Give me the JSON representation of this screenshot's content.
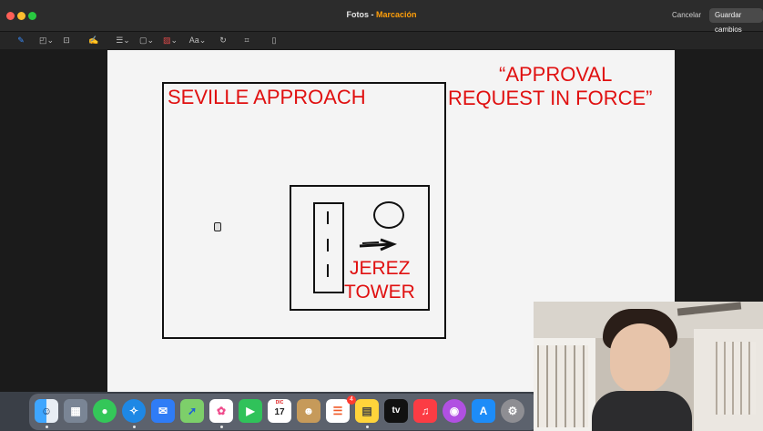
{
  "window": {
    "app_name": "Fotos",
    "separator": " - ",
    "mode": "Marcación",
    "cancel_label": "Cancelar",
    "save_label": "Guardar cambios"
  },
  "toolbar": {
    "tools": [
      "sketch-icon",
      "shapes-icon",
      "text-box-icon",
      "signature-icon",
      "line-style-icon",
      "border-color-icon",
      "fill-color-icon",
      "text-style-icon",
      "rotate-icon",
      "crop-icon",
      "page-icon"
    ],
    "text_style_label": "Aa"
  },
  "drawing": {
    "title_left": "SEVILLE APPROACH",
    "quote_line1": "“APPROVAL",
    "quote_line2": "REQUEST IN FORCE”",
    "tower_line1": "JEREZ",
    "tower_line2": "TOWER"
  },
  "dock": {
    "apps": [
      "finder",
      "launchpad",
      "messages",
      "safari",
      "mail",
      "maps",
      "photos",
      "facetime",
      "calendar",
      "contacts",
      "reminders",
      "notes",
      "tv",
      "music",
      "podcasts",
      "app-store",
      "system-preferences"
    ],
    "calendar_month": "DIC",
    "calendar_day": "17",
    "reminders_badge": "4",
    "tv_label": "tv"
  },
  "colors": {
    "close": "#ff5f57",
    "minimize": "#febc2e",
    "zoom": "#28c840",
    "accent": "#ff9f0a",
    "ink_red": "#e01010"
  }
}
